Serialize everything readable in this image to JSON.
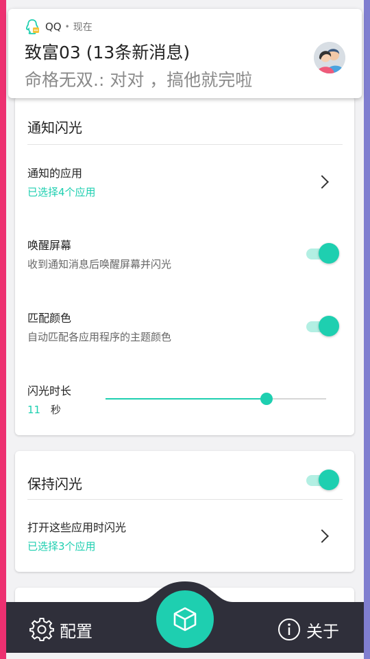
{
  "notification": {
    "app": "QQ",
    "time": "现在",
    "title": "致富03 (13条新消息)",
    "message": "命格无双.: 对对 ，搞他就完啦",
    "icon": "qq-penguin-icon"
  },
  "flash_card": {
    "title": "通知闪光",
    "apps": {
      "label": "通知的应用",
      "value": "已选择4个应用"
    },
    "wake_screen": {
      "label": "唤醒屏幕",
      "description": "收到通知消息后唤醒屏幕并闪光",
      "enabled": true
    },
    "match_color": {
      "label": "匹配颜色",
      "description": "自动匹配各应用程序的主题颜色",
      "enabled": true
    },
    "duration": {
      "label": "闪光时长",
      "value": "11",
      "unit": "秒",
      "fraction": 0.73
    }
  },
  "keep_card": {
    "title": "保持闪光",
    "enabled": true,
    "apps": {
      "label": "打开这些应用时闪光",
      "value": "已选择3个应用"
    }
  },
  "bottom_nav": {
    "config_label": "配置",
    "about_label": "关于"
  },
  "colors": {
    "accent": "#1ecfb0",
    "bar": "#2f2f3a"
  }
}
